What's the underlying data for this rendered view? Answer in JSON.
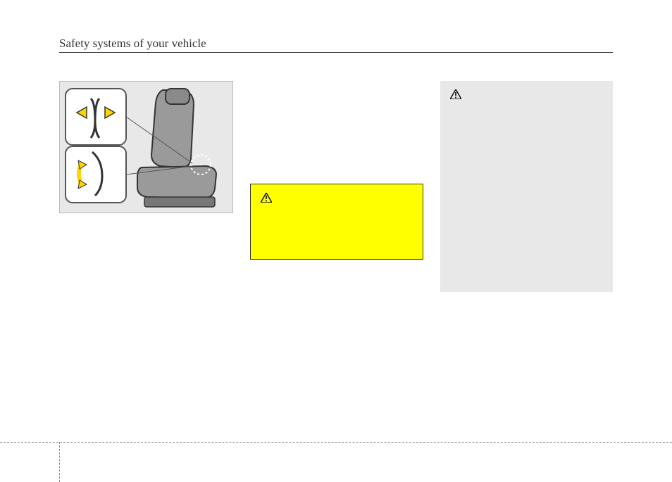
{
  "header": {
    "title": "Safety systems of your vehicle"
  },
  "figure": {
    "alt": "Seat lumbar support adjustment illustration",
    "icons": {
      "arrow_left": "←",
      "arrow_right": "→",
      "arrow_curve": "↕"
    }
  },
  "caution": {
    "icon_name": "warning-triangle",
    "label": ""
  },
  "warning": {
    "icon_name": "warning-triangle",
    "label": ""
  }
}
